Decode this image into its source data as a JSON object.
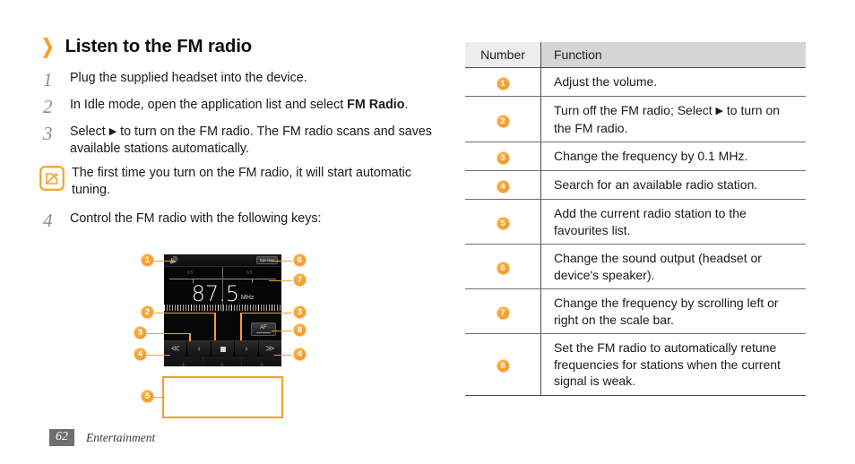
{
  "heading": {
    "chevron_icon": "chevron-right-icon",
    "title": "Listen to the FM radio"
  },
  "steps": [
    {
      "num": "1",
      "html": "Plug the supplied headset into the device."
    },
    {
      "num": "2",
      "html": "In Idle mode, open the application list and select <b>FM Radio</b>."
    },
    {
      "num": "3",
      "html": "Select <span class=\"tri\">▶</span> to turn on the FM radio. The FM radio scans and saves available stations automatically."
    },
    {
      "num": "4",
      "html": "Control the FM radio with the following keys:"
    }
  ],
  "note": {
    "icon": "note-pencil-icon",
    "text": "The first time you turn on the FM radio, it will start automatic tuning."
  },
  "phone": {
    "volume_icon": "speaker-volume-icon",
    "speaker_button": "Speaker",
    "scale_left_label": "85",
    "scale_right_label": "90",
    "frequency": "87.5",
    "frequency_unit": "MHz",
    "af_button": "AF",
    "af_icon": "af-toggle-icon",
    "transport": [
      {
        "icon": "rewind-scan-icon",
        "glyph": "≪"
      },
      {
        "icon": "step-back-icon",
        "glyph": "‹"
      },
      {
        "icon": "stop-icon",
        "glyph": ""
      },
      {
        "icon": "step-forward-icon",
        "glyph": "›"
      },
      {
        "icon": "fast-forward-scan-icon",
        "glyph": "≫"
      }
    ],
    "favourites": [
      {
        "glyph": "+"
      },
      {
        "glyph": "+"
      },
      {
        "glyph": "+"
      },
      {
        "glyph": "+"
      },
      {
        "glyph": "+"
      },
      {
        "glyph": "+"
      }
    ]
  },
  "callouts": [
    {
      "id": "c1",
      "label": "1"
    },
    {
      "id": "c2",
      "label": "2"
    },
    {
      "id": "c3l",
      "label": "3"
    },
    {
      "id": "c4l",
      "label": "4"
    },
    {
      "id": "c5",
      "label": "5"
    },
    {
      "id": "c6",
      "label": "6"
    },
    {
      "id": "c7",
      "label": "7"
    },
    {
      "id": "c3r",
      "label": "3"
    },
    {
      "id": "c8",
      "label": "8"
    },
    {
      "id": "c4r",
      "label": "4"
    }
  ],
  "table": {
    "headers": {
      "number": "Number",
      "function": "Function"
    },
    "rows": [
      {
        "number": "1",
        "function": "Adjust the volume."
      },
      {
        "number": "2",
        "function_html": "Turn off the FM radio; Select <span class=\"tri\">▶</span> to turn on the FM radio."
      },
      {
        "number": "3",
        "function": "Change the frequency by 0.1 MHz."
      },
      {
        "number": "4",
        "function": "Search for an available radio station."
      },
      {
        "number": "5",
        "function": "Add the current radio station to the favourites list."
      },
      {
        "number": "6",
        "function": "Change the sound output (headset or device's speaker)."
      },
      {
        "number": "7",
        "function": "Change the frequency by scrolling left or right on the scale bar."
      },
      {
        "number": "8",
        "function": "Set the FM radio to automatically retune frequencies for stations when the current signal is weak."
      }
    ]
  },
  "footer": {
    "page_number": "62",
    "section": "Entertainment"
  },
  "colors": {
    "accent_orange": "#f5a02a",
    "badge_orange": "#ef8f22",
    "header_gray_light": "#ededed",
    "header_gray_dark": "#d6d6d6",
    "rule_gray": "#6e6e6e",
    "footer_page_bg": "#6f6f6f"
  }
}
